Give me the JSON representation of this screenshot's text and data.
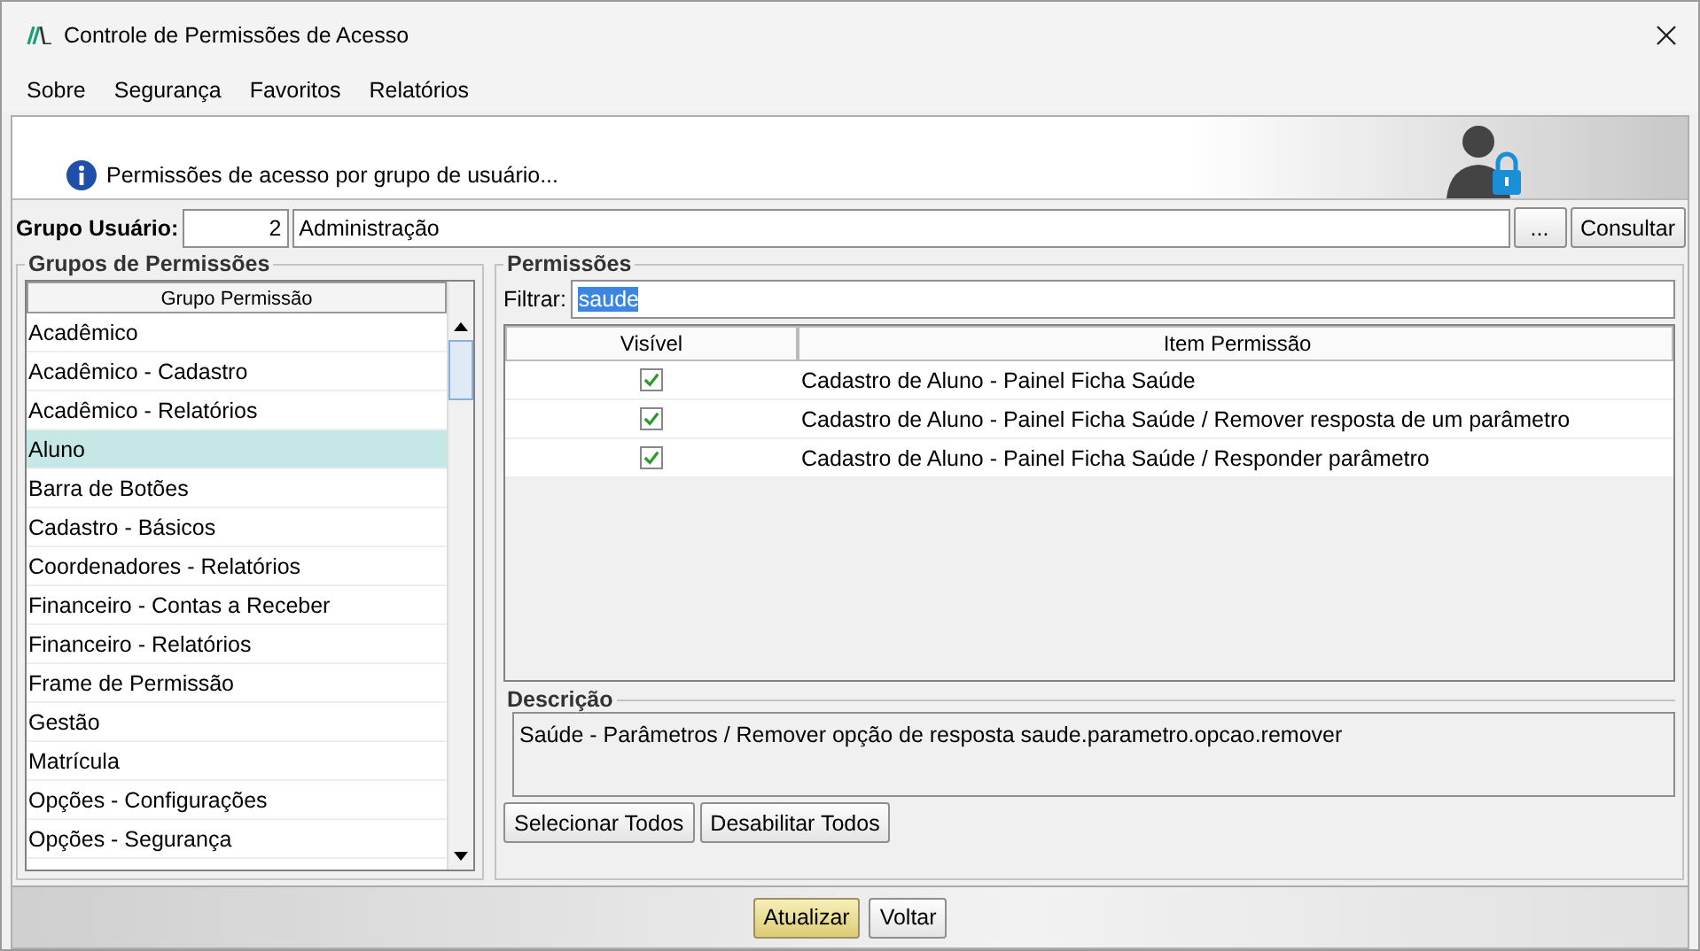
{
  "window": {
    "title": "Controle de Permissões de Acesso"
  },
  "menu": [
    "Sobre",
    "Segurança",
    "Favoritos",
    "Relatórios"
  ],
  "header": {
    "message": "Permissões de acesso por grupo de usuário..."
  },
  "user_group": {
    "label": "Grupo Usuário:",
    "code": "2",
    "name": "Administração",
    "browse_button": "...",
    "search_button": "Consultar"
  },
  "groups_panel": {
    "title": "Grupos de Permissões",
    "column": "Grupo Permissão",
    "items": [
      {
        "label": "Acadêmico",
        "selected": false
      },
      {
        "label": "Acadêmico - Cadastro",
        "selected": false
      },
      {
        "label": "Acadêmico - Relatórios",
        "selected": false
      },
      {
        "label": "Aluno",
        "selected": true
      },
      {
        "label": "Barra de Botões",
        "selected": false
      },
      {
        "label": "Cadastro - Básicos",
        "selected": false
      },
      {
        "label": "Coordenadores - Relatórios",
        "selected": false
      },
      {
        "label": "Financeiro - Contas a Receber",
        "selected": false
      },
      {
        "label": "Financeiro - Relatórios",
        "selected": false
      },
      {
        "label": "Frame de Permissão",
        "selected": false
      },
      {
        "label": "Gestão",
        "selected": false
      },
      {
        "label": "Matrícula",
        "selected": false
      },
      {
        "label": "Opções - Configurações",
        "selected": false
      },
      {
        "label": "Opções - Segurança",
        "selected": false
      }
    ]
  },
  "permissions_panel": {
    "title": "Permissões",
    "filter_label": "Filtrar:",
    "filter_value": "saude",
    "columns": [
      "Visível",
      "Item Permissão"
    ],
    "rows": [
      {
        "visible": true,
        "item": "Cadastro de Aluno - Painel Ficha Saúde"
      },
      {
        "visible": true,
        "item": "Cadastro de Aluno - Painel Ficha Saúde / Remover resposta de um parâmetro"
      },
      {
        "visible": true,
        "item": "Cadastro de Aluno - Painel Ficha Saúde / Responder parâmetro"
      }
    ],
    "description_title": "Descrição",
    "description": "Saúde - Parâmetros / Remover opção de resposta saude.parametro.opcao.remover",
    "buttons": [
      "Selecionar Todos",
      "Desabilitar Todos"
    ]
  },
  "footer_buttons": [
    {
      "label": "Atualizar",
      "primary": true
    },
    {
      "label": "Voltar",
      "primary": false
    }
  ]
}
